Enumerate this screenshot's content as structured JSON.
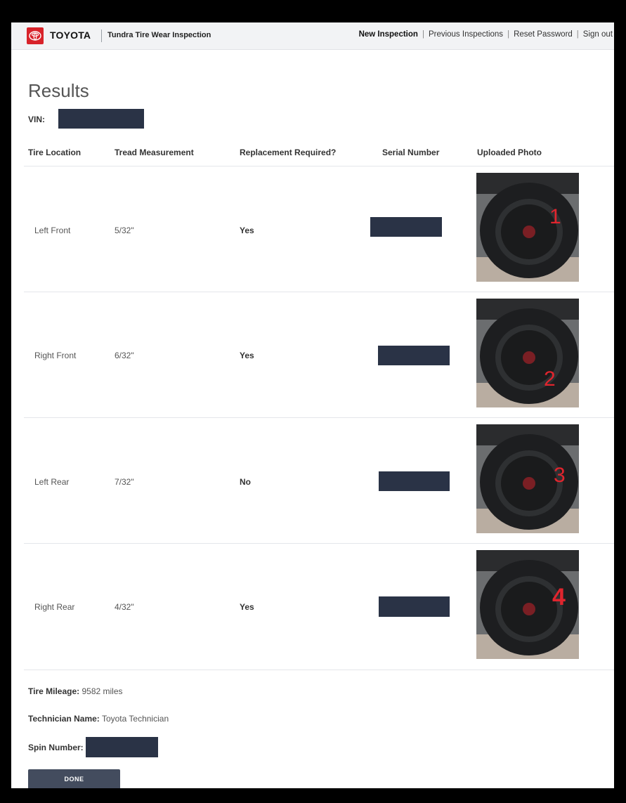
{
  "header": {
    "brand": "TOYOTA",
    "app_title": "Tundra Tire Wear Inspection",
    "nav": [
      "New Inspection",
      "Previous Inspections",
      "Reset Password",
      "Sign out"
    ],
    "brand_color": "#d8232a"
  },
  "page": {
    "title": "Results",
    "vin_label": "VIN:"
  },
  "table": {
    "headers": [
      "Tire Location",
      "Tread Measurement",
      "Replacement Required?",
      "Serial Number",
      "Uploaded Photo"
    ],
    "rows": [
      {
        "location": "Left Front",
        "tread": "5/32\"",
        "replacement": "Yes",
        "photo_mark": "1"
      },
      {
        "location": "Right Front",
        "tread": "6/32\"",
        "replacement": "Yes",
        "photo_mark": "2"
      },
      {
        "location": "Left Rear",
        "tread": "7/32\"",
        "replacement": "No",
        "photo_mark": "3"
      },
      {
        "location": "Right Rear",
        "tread": "4/32\"",
        "replacement": "Yes",
        "photo_mark": "4"
      }
    ]
  },
  "footer": {
    "mileage_label": "Tire Mileage:",
    "mileage_value": "9582 miles",
    "technician_label": "Technician Name:",
    "technician_value": "Toyota Technician",
    "spin_label": "Spin Number:",
    "done_label": "DONE"
  }
}
